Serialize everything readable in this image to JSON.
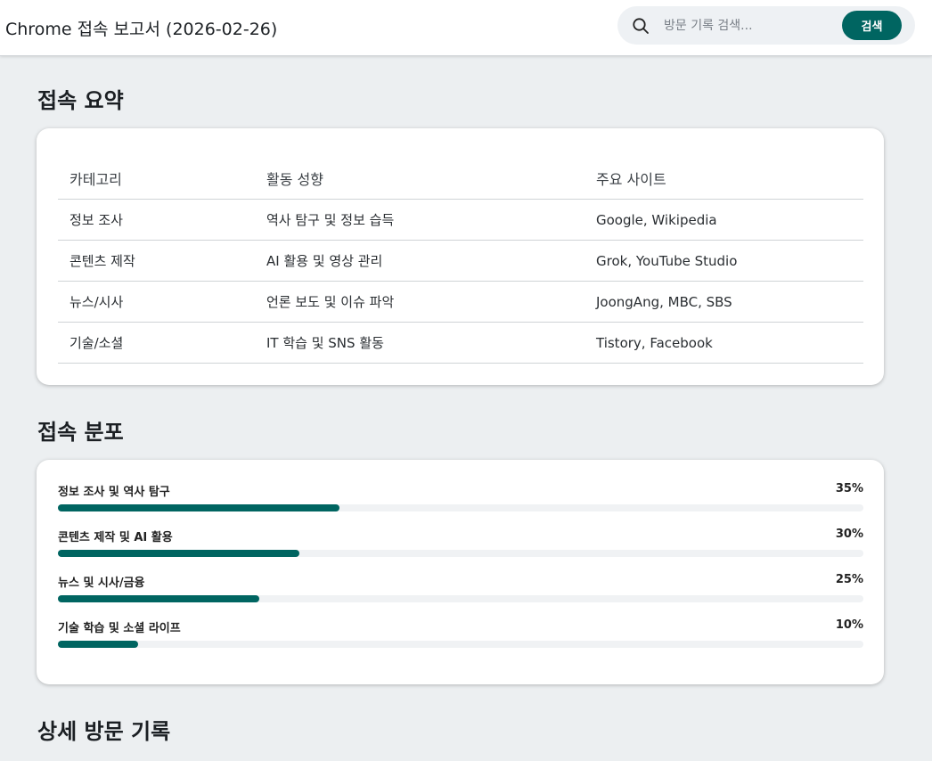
{
  "header": {
    "title": "Chrome 접속 보고서 (2026-02-26)",
    "search": {
      "icon": "search-icon",
      "placeholder": "방문 기록 검색...",
      "value": "",
      "button_label": "검색"
    }
  },
  "summary": {
    "title": "접속 요약",
    "columns": [
      "카테고리",
      "활동 성향",
      "주요 사이트"
    ],
    "rows": [
      [
        "정보 조사",
        "역사 탐구 및 정보 습득",
        "Google, Wikipedia"
      ],
      [
        "콘텐츠 제작",
        "AI 활용 및 영상 관리",
        "Grok, YouTube Studio"
      ],
      [
        "뉴스/시사",
        "언론 보도 및 이슈 파악",
        "JoongAng, MBC, SBS"
      ],
      [
        "기술/소셜",
        "IT 학습 및 SNS 활동",
        "Tistory, Facebook"
      ]
    ]
  },
  "distribution": {
    "title": "접속 분포",
    "items": [
      {
        "label": "정보 조사 및 역사 탐구",
        "percent_label": "35%",
        "value": 35
      },
      {
        "label": "콘텐츠 제작 및 AI 활용",
        "percent_label": "30%",
        "value": 30
      },
      {
        "label": "뉴스 및 시사/금융",
        "percent_label": "25%",
        "value": 25
      },
      {
        "label": "기술 학습 및 소셜 라이프",
        "percent_label": "10%",
        "value": 10
      }
    ]
  },
  "details": {
    "title": "상세 방문 기록"
  },
  "colors": {
    "accent": "#006561",
    "track": "#f0f2f4",
    "background": "#eceff1"
  }
}
